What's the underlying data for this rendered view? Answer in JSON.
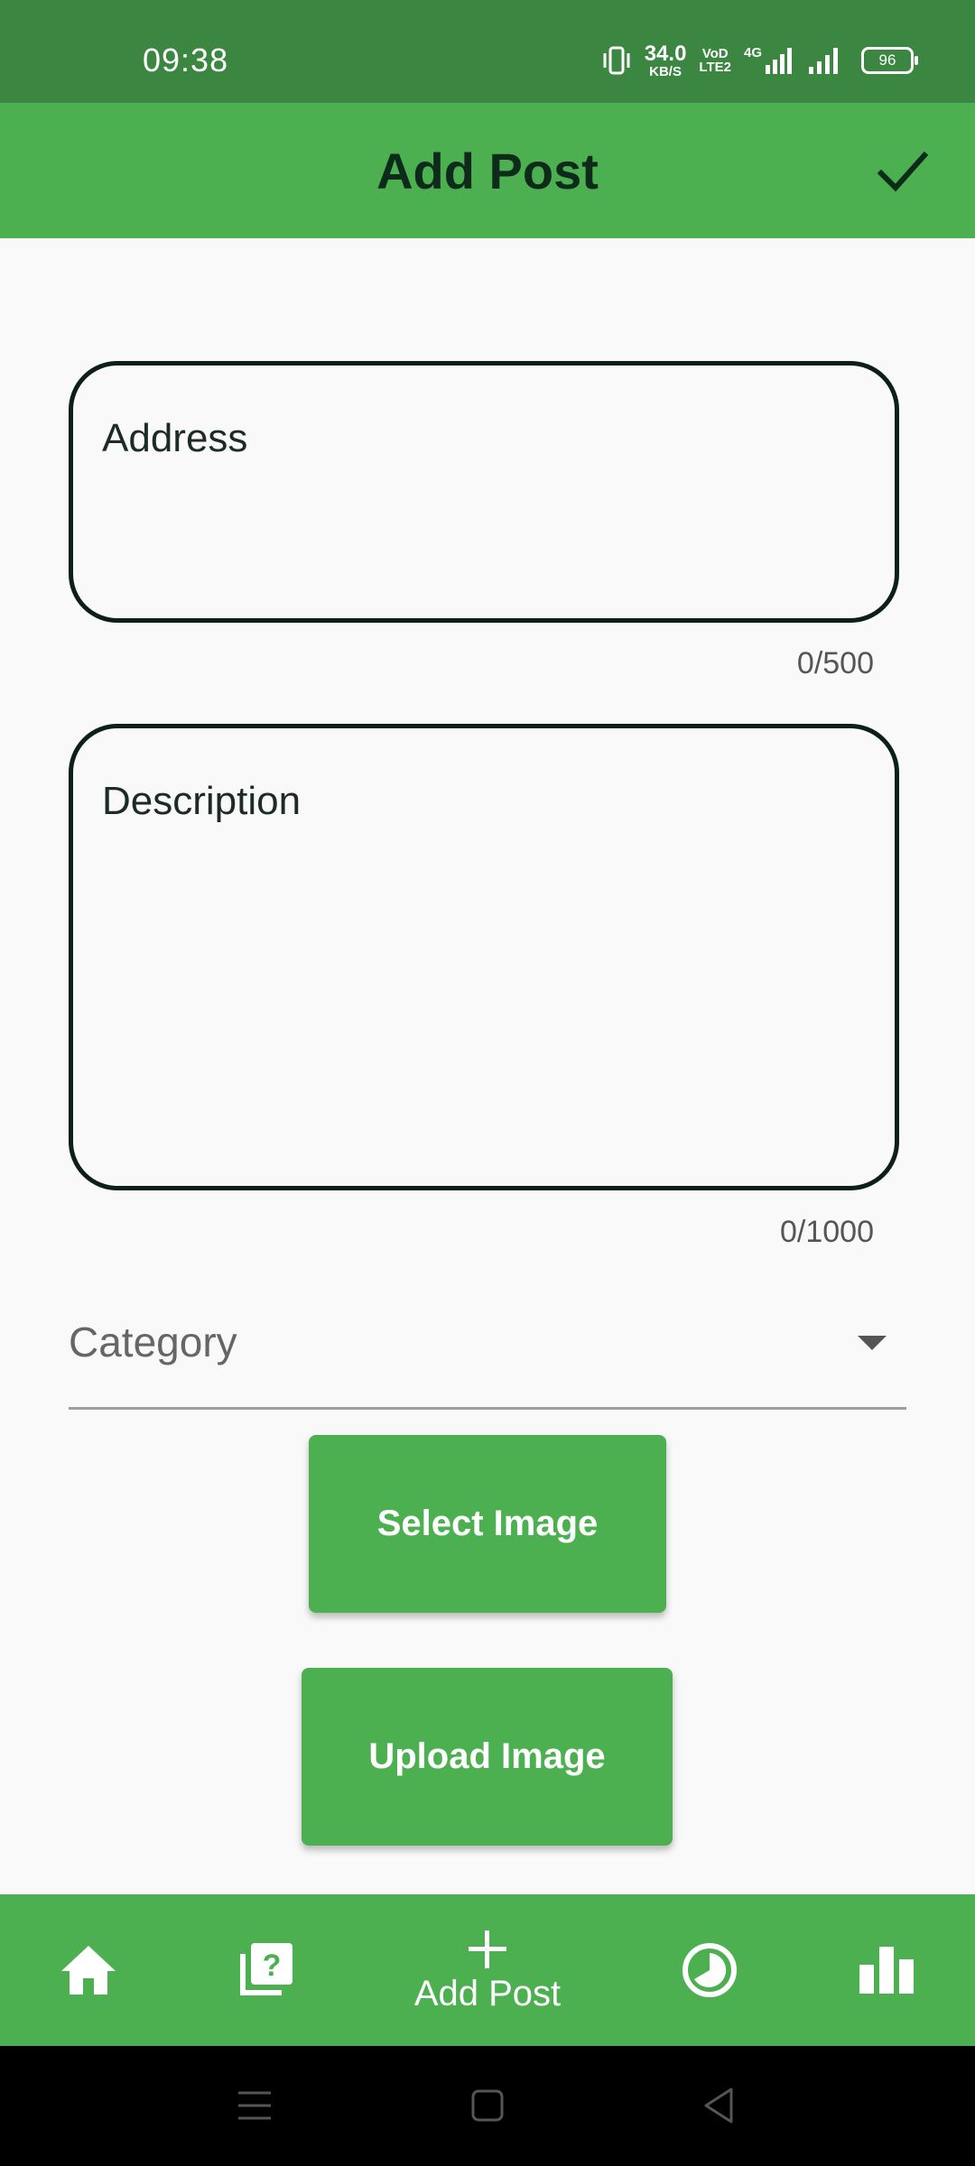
{
  "status_bar": {
    "time": "09:38",
    "net_speed_value": "34.0",
    "net_speed_unit": "KB/S",
    "volte_top": "VoD",
    "volte_bottom": "LTE2",
    "network_type": "4G",
    "battery_level": "96"
  },
  "app_bar": {
    "title": "Add Post",
    "confirm_icon": "check-icon"
  },
  "form": {
    "address": {
      "placeholder": "Address",
      "counter": "0/500"
    },
    "description": {
      "placeholder": "Description",
      "counter": "0/1000"
    },
    "category": {
      "label": "Category"
    },
    "select_image_label": "Select Image",
    "upload_image_label": "Upload Image"
  },
  "bottom_nav": {
    "items": [
      {
        "icon": "home-icon",
        "label": ""
      },
      {
        "icon": "question-library-icon",
        "label": ""
      },
      {
        "icon": "add-icon",
        "label": "Add Post"
      },
      {
        "icon": "pie-chart-icon",
        "label": ""
      },
      {
        "icon": "bar-chart-icon",
        "label": ""
      }
    ]
  },
  "colors": {
    "status_bar": "#3b8640",
    "primary": "#4caf50",
    "title_text": "#0e2a1b",
    "field_border": "#0c1f1a",
    "background": "#f9f9f9"
  }
}
